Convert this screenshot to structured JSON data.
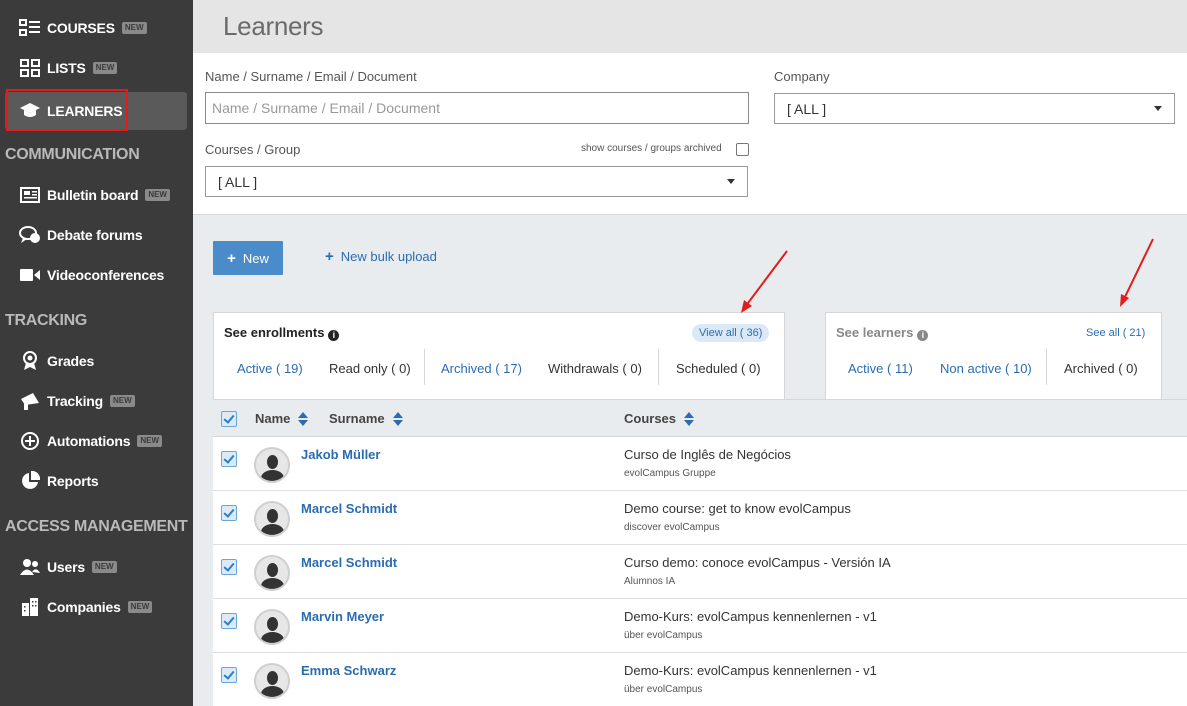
{
  "sidebar": {
    "items": [
      {
        "label": "COURSES",
        "badge": "NEW",
        "icon": "list-icon"
      },
      {
        "label": "LISTS",
        "badge": "NEW",
        "icon": "grid-icon"
      },
      {
        "label": "LEARNERS",
        "badge": "",
        "icon": "graduation-cap-icon"
      },
      {
        "label": "Bulletin board",
        "badge": "NEW",
        "icon": "newspaper-icon"
      },
      {
        "label": "Debate forums",
        "badge": "",
        "icon": "chat-icon"
      },
      {
        "label": "Videoconferences",
        "badge": "",
        "icon": "video-camera-icon"
      },
      {
        "label": "Grades",
        "badge": "",
        "icon": "award-icon"
      },
      {
        "label": "Tracking",
        "badge": "NEW",
        "icon": "megaphone-icon"
      },
      {
        "label": "Automations",
        "badge": "NEW",
        "icon": "plus-circle-icon"
      },
      {
        "label": "Reports",
        "badge": "",
        "icon": "pie-chart-icon"
      },
      {
        "label": "Users",
        "badge": "NEW",
        "icon": "users-icon"
      },
      {
        "label": "Companies",
        "badge": "NEW",
        "icon": "building-icon"
      }
    ],
    "sections": {
      "communication": "COMMUNICATION",
      "tracking": "TRACKING",
      "access": "ACCESS MANAGEMENT"
    }
  },
  "header": {
    "title": "Learners"
  },
  "filters": {
    "name_label": "Name / Surname / Email / Document",
    "name_placeholder": "Name / Surname / Email / Document",
    "company_label": "Company",
    "company_value": "[ ALL ]",
    "courses_label": "Courses / Group",
    "courses_value": "[ ALL ]",
    "show_archived_label": "show courses / groups archived"
  },
  "actions": {
    "new_label": "New",
    "bulk_label": "New bulk upload"
  },
  "enrollments": {
    "title": "See enrollments",
    "view_all": "View all ( 36)",
    "tabs": [
      "Active ( 19)",
      "Read only ( 0)",
      "Archived ( 17)",
      "Withdrawals ( 0)",
      "Scheduled ( 0)"
    ]
  },
  "learners_panel": {
    "title": "See learners",
    "see_all": "See all ( 21)",
    "tabs": [
      "Active ( 11)",
      "Non active ( 10)",
      "Archived ( 0)"
    ]
  },
  "table": {
    "headers": {
      "name": "Name",
      "surname": "Surname",
      "courses": "Courses"
    },
    "rows": [
      {
        "name": "Jakob Müller",
        "course": "Curso de Inglês de Negócios",
        "group": "evolCampus Gruppe"
      },
      {
        "name": "Marcel Schmidt",
        "course": "Demo course: get to know evolCampus",
        "group": "discover evolCampus"
      },
      {
        "name": "Marcel Schmidt",
        "course": "Curso demo: conoce evolCampus - Versión IA",
        "group": "Alumnos IA"
      },
      {
        "name": "Marvin Meyer",
        "course": "Demo-Kurs: evolCampus kennenlernen - v1",
        "group": "über evolCampus"
      },
      {
        "name": "Emma Schwarz",
        "course": "Demo-Kurs: evolCampus kennenlernen - v1",
        "group": "über evolCampus"
      }
    ]
  },
  "colors": {
    "sidebar_bg": "#3b3b3b",
    "accent": "#4a8bc9",
    "link": "#2b6cb0",
    "highlight": "#e31b1b"
  }
}
